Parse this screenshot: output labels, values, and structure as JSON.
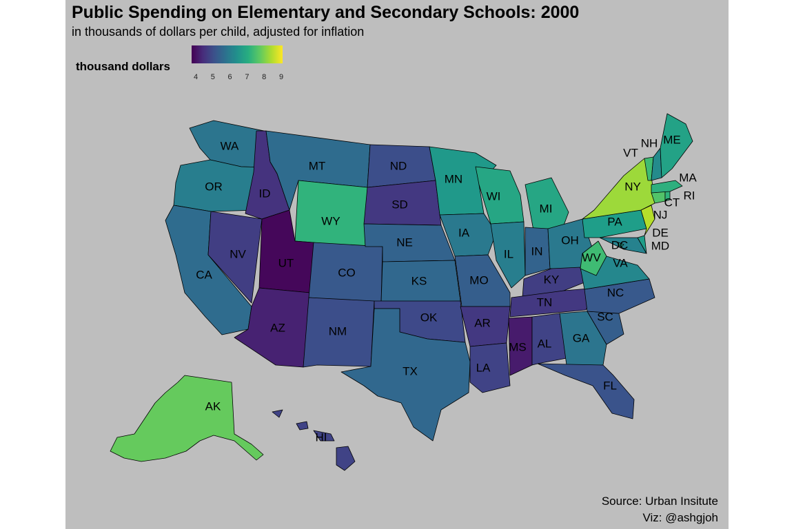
{
  "title": "Public Spending on Elementary and Secondary Schools: 2000",
  "subtitle": "in thousands of dollars per child, adjusted for inflation",
  "legend": {
    "title": "thousand dollars",
    "ticks": [
      "4",
      "5",
      "6",
      "7",
      "8",
      "9"
    ],
    "range": [
      3.7,
      9.1
    ],
    "palette": "viridis"
  },
  "caption": {
    "source": "Source: Urban Insitute",
    "viz": "Viz: @ashgjoh"
  },
  "background_color": "#bebebe",
  "map_data": {
    "type": "choropleth",
    "region": "United States",
    "year": 2000,
    "states": [
      {
        "abbr": "WA",
        "value": 5.8
      },
      {
        "abbr": "OR",
        "value": 6.0
      },
      {
        "abbr": "CA",
        "value": 5.6
      },
      {
        "abbr": "NV",
        "value": 4.7
      },
      {
        "abbr": "ID",
        "value": 4.5
      },
      {
        "abbr": "MT",
        "value": 5.6
      },
      {
        "abbr": "WY",
        "value": 7.2
      },
      {
        "abbr": "UT",
        "value": 3.8
      },
      {
        "abbr": "AZ",
        "value": 4.2
      },
      {
        "abbr": "CO",
        "value": 5.2
      },
      {
        "abbr": "NM",
        "value": 5.0
      },
      {
        "abbr": "ND",
        "value": 5.0
      },
      {
        "abbr": "SD",
        "value": 4.6
      },
      {
        "abbr": "NE",
        "value": 5.4
      },
      {
        "abbr": "KS",
        "value": 5.5
      },
      {
        "abbr": "OK",
        "value": 4.9
      },
      {
        "abbr": "TX",
        "value": 5.5
      },
      {
        "abbr": "MN",
        "value": 6.6
      },
      {
        "abbr": "IA",
        "value": 5.9
      },
      {
        "abbr": "MO",
        "value": 5.3
      },
      {
        "abbr": "AR",
        "value": 4.6
      },
      {
        "abbr": "LA",
        "value": 4.8
      },
      {
        "abbr": "WI",
        "value": 6.9
      },
      {
        "abbr": "IL",
        "value": 6.0
      },
      {
        "abbr": "MI",
        "value": 6.9
      },
      {
        "abbr": "IN",
        "value": 5.4
      },
      {
        "abbr": "OH",
        "value": 5.9
      },
      {
        "abbr": "KY",
        "value": 4.7
      },
      {
        "abbr": "TN",
        "value": 4.6
      },
      {
        "abbr": "MS",
        "value": 4.1
      },
      {
        "abbr": "AL",
        "value": 4.8
      },
      {
        "abbr": "GA",
        "value": 5.8
      },
      {
        "abbr": "FL",
        "value": 5.1
      },
      {
        "abbr": "SC",
        "value": 5.3
      },
      {
        "abbr": "NC",
        "value": 5.2
      },
      {
        "abbr": "VA",
        "value": 6.2
      },
      {
        "abbr": "WV",
        "value": 7.4
      },
      {
        "abbr": "MD",
        "value": 6.1
      },
      {
        "abbr": "DE",
        "value": 6.7
      },
      {
        "abbr": "DC",
        "value": 6.8
      },
      {
        "abbr": "PA",
        "value": 6.7
      },
      {
        "abbr": "NJ",
        "value": 8.5
      },
      {
        "abbr": "NY",
        "value": 8.3
      },
      {
        "abbr": "CT",
        "value": 7.6
      },
      {
        "abbr": "RI",
        "value": 7.2
      },
      {
        "abbr": "MA",
        "value": 7.1
      },
      {
        "abbr": "VT",
        "value": 7.4
      },
      {
        "abbr": "NH",
        "value": 6.3
      },
      {
        "abbr": "ME",
        "value": 6.8
      },
      {
        "abbr": "AK",
        "value": 7.8
      },
      {
        "abbr": "HI",
        "value": 4.8
      }
    ]
  }
}
